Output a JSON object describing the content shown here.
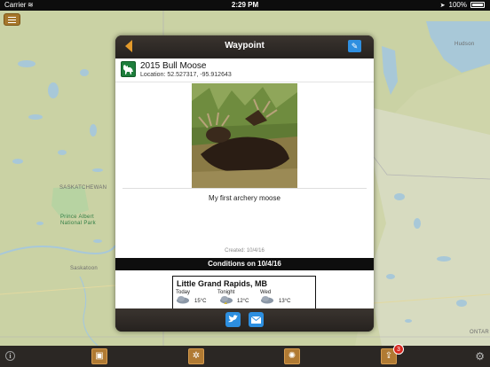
{
  "status_bar": {
    "carrier": "Carrier",
    "time": "2:29 PM",
    "battery": "100%"
  },
  "map": {
    "labels": {
      "saskatchewan": "SASKATCHEWAN",
      "prince_albert": "Prince Albert",
      "national_park": "National Park",
      "saskatoon": "Saskatoon",
      "hudson": "Hudson",
      "ontario": "ONTAR"
    },
    "colors": {
      "land": "#cfd5aa",
      "water": "#a8c8d8",
      "forest": "#b9c799"
    }
  },
  "modal": {
    "title": "Waypoint",
    "waypoint": {
      "name": "2015 Bull Moose",
      "location_label": "Location: 52.527317, -95.912643",
      "caption": "My first archery moose",
      "created": "Created: 10/4/16"
    },
    "conditions": {
      "header": "Conditions on 10/4/16",
      "city": "Little Grand Rapids, MB",
      "days": [
        {
          "label": "Today",
          "temp": "15°C"
        },
        {
          "label": "Tonight",
          "temp": "12°C"
        },
        {
          "label": "Wed",
          "temp": "13°C"
        }
      ]
    }
  },
  "toolbar": {
    "notification_count": "3"
  },
  "icons": {
    "menu": "hamburger-icon",
    "back": "back-arrow-icon",
    "edit": "pencil-icon",
    "twitter": "twitter-icon",
    "email": "email-icon",
    "info": "info-icon",
    "settings": "gear-icon"
  }
}
